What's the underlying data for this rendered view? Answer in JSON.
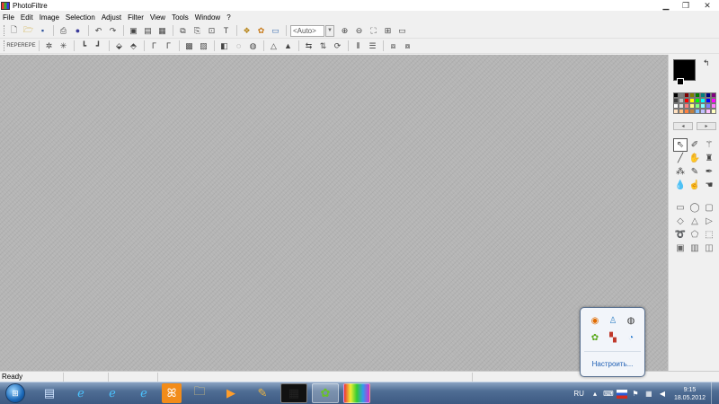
{
  "window": {
    "title": "PhotoFiltre",
    "controls": [
      "minimize",
      "restore",
      "close"
    ]
  },
  "menu": [
    "File",
    "Edit",
    "Image",
    "Selection",
    "Adjust",
    "Filter",
    "View",
    "Tools",
    "Window",
    "?"
  ],
  "toolbar1": {
    "zoom_value": "<Auto>"
  },
  "toolbar2": {
    "icon_a_label": "REPE",
    "icon_b_label": "REPE"
  },
  "colors": {
    "foreground": "#000000",
    "background": "#000000",
    "palette": [
      "#000000",
      "#808080",
      "#800000",
      "#808000",
      "#008000",
      "#008080",
      "#000080",
      "#800080",
      "#404040",
      "#c0c0c0",
      "#ff0000",
      "#ffff00",
      "#00ff00",
      "#00ffff",
      "#0000ff",
      "#ff00ff",
      "#ffffff",
      "#e0e0e0",
      "#ff8080",
      "#ffff80",
      "#80ff80",
      "#80ffff",
      "#8080ff",
      "#ff80ff",
      "#ffe0c0",
      "#ffc080",
      "#ff8040",
      "#c08040",
      "#80c0ff",
      "#c0c0ff",
      "#ffc0ff",
      "#ffffc0"
    ],
    "workspace": "#b5b5b5"
  },
  "palette_nav": {
    "prev": "◂",
    "next": "▸"
  },
  "status": {
    "text": "Ready"
  },
  "taskbar": {
    "language": "RU",
    "time": "9:15",
    "date": "18.05.2012"
  },
  "tray_popup": {
    "customize_link": "Настроить..."
  }
}
